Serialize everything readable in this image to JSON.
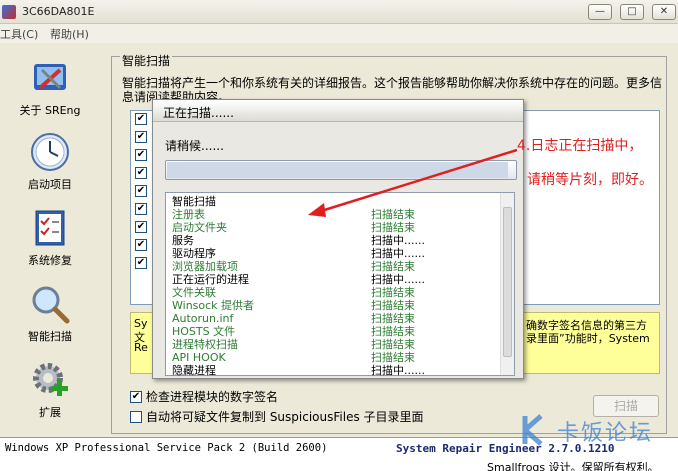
{
  "window": {
    "title": "3C66DA801E",
    "min_label": "—",
    "max_label": "□",
    "close_label": "✕"
  },
  "menu": [
    "工具(C)",
    "帮助(H)"
  ],
  "sidebar": {
    "items": [
      {
        "label": "关于 SREng",
        "icon": "sreng-tools-icon"
      },
      {
        "label": "启动项目",
        "icon": "clock-icon"
      },
      {
        "label": "系统修复",
        "icon": "checklist-icon"
      },
      {
        "label": "智能扫描",
        "icon": "magnifier-icon"
      },
      {
        "label": "扩展",
        "icon": "gear-plus-icon"
      }
    ]
  },
  "panel": {
    "title": "智能扫描",
    "description": "智能扫描将产生一个和你系统有关的详细报告。这个报告能够帮助你解决你系统中存在的问题。更多信息请阅读帮助内容。"
  },
  "yellow_box": {
    "left_lines": [
      "Sy",
      "文",
      "Re"
    ],
    "right_line1": "确数字签名信息的第三方",
    "right_line2": "录里面”功能时，System"
  },
  "options": {
    "verify_signature": {
      "label": "检查进程模块的数字签名",
      "checked": true
    },
    "copy_suspicious": {
      "label": "自动将可疑文件复制到 SuspiciousFiles 子目录里面",
      "checked": false
    }
  },
  "scan_button": "扫描",
  "dialog": {
    "title": "正在扫描......",
    "wait_text": "请稍候......",
    "progress_fraction": 0.98,
    "rows": [
      {
        "name": "智能扫描",
        "status": "",
        "color": "#000000"
      },
      {
        "name": "注册表",
        "status": "扫描结束",
        "color": "#2e7d32"
      },
      {
        "name": "启动文件夹",
        "status": "扫描结束",
        "color": "#2e7d32"
      },
      {
        "name": "服务",
        "status": "扫描中......",
        "color": "#000000"
      },
      {
        "name": "驱动程序",
        "status": "扫描中......",
        "color": "#000000"
      },
      {
        "name": "浏览器加载项",
        "status": "扫描结束",
        "color": "#2e7d32"
      },
      {
        "name": "正在运行的进程",
        "status": "扫描中......",
        "color": "#000000"
      },
      {
        "name": "文件关联",
        "status": "扫描结束",
        "color": "#2e7d32"
      },
      {
        "name": "Winsock 提供者",
        "status": "扫描结束",
        "color": "#2e7d32"
      },
      {
        "name": "Autorun.inf",
        "status": "扫描结束",
        "color": "#2e7d32"
      },
      {
        "name": "HOSTS 文件",
        "status": "扫描结束",
        "color": "#2e7d32"
      },
      {
        "name": "进程特权扫描",
        "status": "扫描结束",
        "color": "#2e7d32"
      },
      {
        "name": "API HOOK",
        "status": "扫描结束",
        "color": "#2e7d32"
      },
      {
        "name": "隐藏进程",
        "status": "扫描中......",
        "color": "#000000"
      }
    ]
  },
  "annotation": {
    "line1": "4.日志正在扫描中，",
    "line2": "请稍等片刻，即好。",
    "color": "#e02020"
  },
  "status": {
    "os": "Windows XP Professional Service Pack 2 (Build 2600)",
    "product": "System Repair Engineer 2.7.0.1210",
    "copyright": "Smallfrogs 设计。保留所有权利。"
  },
  "watermark": {
    "text": "卡饭论坛"
  }
}
